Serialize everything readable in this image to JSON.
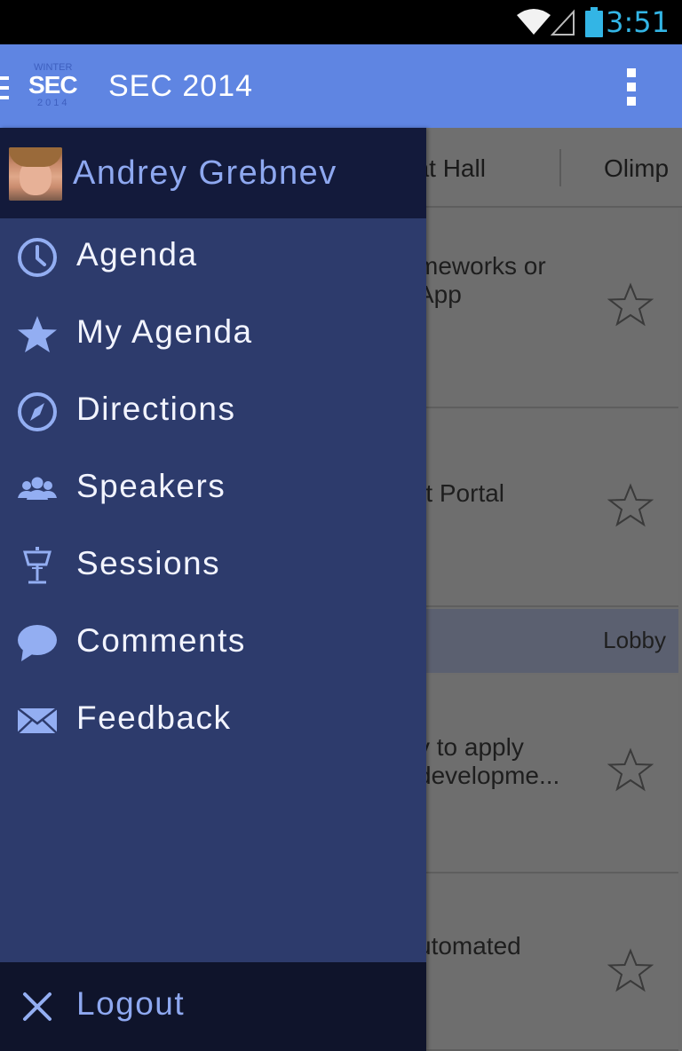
{
  "status_bar": {
    "time": "3:51"
  },
  "action_bar": {
    "logo_text": "SEC",
    "logo_top": "WINTER",
    "logo_bottom": "2014",
    "title": "SEC 2014"
  },
  "content": {
    "tabs": [
      {
        "label": "hat Hall"
      },
      {
        "label": "Olimp"
      }
    ],
    "sessions": [
      {
        "title": "meworks or\nApp"
      },
      {
        "title": "rt Portal"
      },
      {
        "title": "v to apply\ndevelopme..."
      },
      {
        "title": "utomated"
      }
    ],
    "lobby_label": "Lobby"
  },
  "drawer": {
    "user_name": "Andrey Grebnev",
    "items": [
      {
        "label": "Agenda",
        "icon": "clock-icon"
      },
      {
        "label": "My Agenda",
        "icon": "star-icon"
      },
      {
        "label": "Directions",
        "icon": "compass-icon"
      },
      {
        "label": "Speakers",
        "icon": "people-icon"
      },
      {
        "label": "Sessions",
        "icon": "podium-icon"
      },
      {
        "label": "Comments",
        "icon": "speech-bubble-icon"
      },
      {
        "label": "Feedback",
        "icon": "envelope-icon"
      }
    ],
    "logout_label": "Logout"
  },
  "colors": {
    "action_bar": "#5f85e2",
    "drawer_bg": "#2d3b6c",
    "drawer_header": "#131a3b",
    "drawer_footer": "#0f142b",
    "accent_light": "#8ea8f0",
    "status_time": "#33b5e5"
  }
}
